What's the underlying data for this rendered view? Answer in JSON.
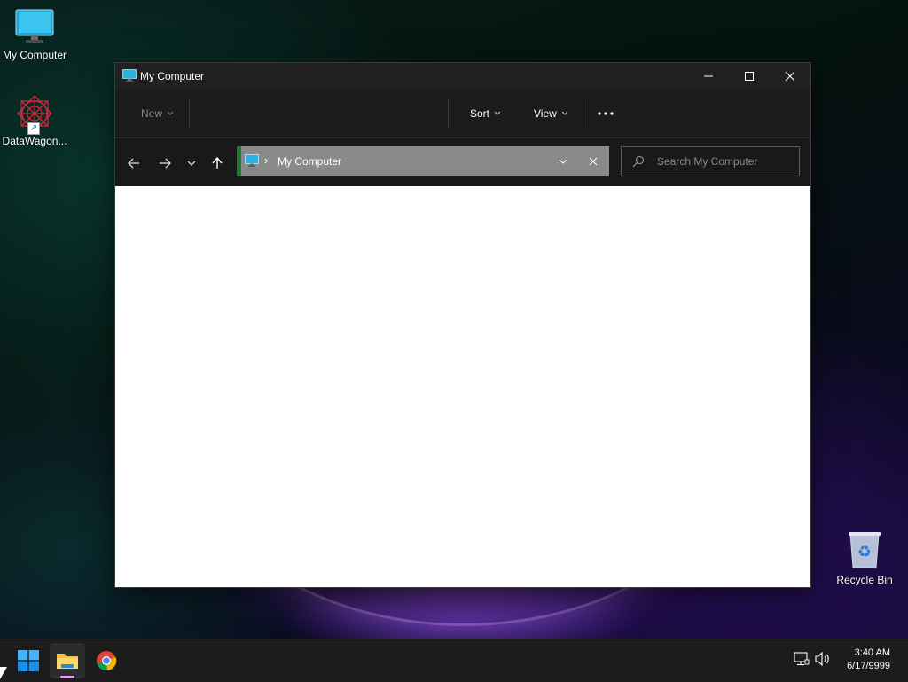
{
  "desktop": {
    "icons": [
      {
        "label": "My Computer",
        "icon": "monitor-icon"
      },
      {
        "label": "DataWagon...",
        "icon": "datawagon-logo-icon"
      },
      {
        "label": "Recycle Bin",
        "icon": "recycle-bin-icon"
      }
    ]
  },
  "window": {
    "title": "My Computer",
    "controls": {
      "minimize": "minimize-icon",
      "maximize": "maximize-icon",
      "close": "close-icon"
    },
    "toolbar": {
      "new_label": "New",
      "sort_label": "Sort",
      "view_label": "View",
      "more_icon": "more-options-icon"
    },
    "nav": {
      "back": "back-arrow-icon",
      "forward": "forward-arrow-icon",
      "recent": "chevron-down-icon",
      "up": "up-arrow-icon"
    },
    "address": {
      "path": "My Computer",
      "accent_color": "#1d7a2e",
      "background": "#8a8a8a"
    },
    "search": {
      "placeholder": "Search My Computer"
    }
  },
  "taskbar": {
    "apps": [
      {
        "name": "start",
        "icon": "windows-start-icon"
      },
      {
        "name": "file-explorer",
        "icon": "folder-icon",
        "active": true
      },
      {
        "name": "chrome",
        "icon": "chrome-icon"
      }
    ],
    "tray": {
      "network_icon": "network-icon",
      "volume_icon": "volume-icon"
    },
    "clock": {
      "time": "3:40 AM",
      "date": "6/17/9999"
    }
  },
  "colors": {
    "titlebar": "#202020",
    "toolbar": "#1c1c1c",
    "taskbar": "#1c1c1c",
    "indicator": "#e7a4f0"
  }
}
